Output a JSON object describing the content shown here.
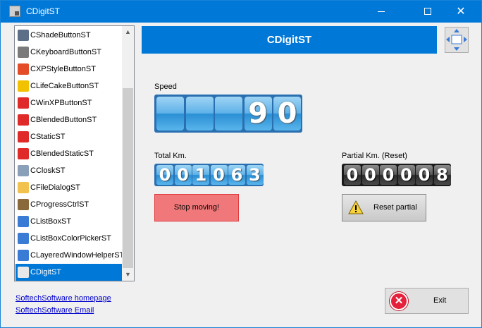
{
  "window": {
    "title": "CDigitST",
    "minimize": "—",
    "maximize": "☐",
    "close": "✕"
  },
  "sidebar": {
    "items": [
      {
        "label": "CShadeButtonST",
        "icon": "person-icon",
        "color": "#5b6f86"
      },
      {
        "label": "CKeyboardButtonST",
        "icon": "keyboard-icon",
        "color": "#7a7a7a"
      },
      {
        "label": "CXPStyleButtonST",
        "icon": "windows-xp-icon",
        "color": "#e34c26"
      },
      {
        "label": "CLifeCakeButtonST",
        "icon": "lifecake-icon",
        "color": "#f2c200"
      },
      {
        "label": "CWinXPButtonST",
        "icon": "color-ball-icon",
        "color": "#e02a2a"
      },
      {
        "label": "CBlendedButtonST",
        "icon": "color-ball-icon",
        "color": "#e02a2a"
      },
      {
        "label": "CStaticST",
        "icon": "color-ball-icon",
        "color": "#e02a2a"
      },
      {
        "label": "CBlendedStaticST",
        "icon": "color-ball-icon",
        "color": "#e02a2a"
      },
      {
        "label": "CCloskST",
        "icon": "clock-icon",
        "color": "#8aa0b8"
      },
      {
        "label": "CFileDialogST",
        "icon": "folder-icon",
        "color": "#f1c34e"
      },
      {
        "label": "CProgressCtrlST",
        "icon": "hourglass-icon",
        "color": "#8a6a3a"
      },
      {
        "label": "CListBoxST",
        "icon": "window-icon",
        "color": "#3a7bd5"
      },
      {
        "label": "CListBoxColorPickerST",
        "icon": "window-icon",
        "color": "#3a7bd5"
      },
      {
        "label": "CLayeredWindowHelperST",
        "icon": "window-icon",
        "color": "#3a7bd5"
      },
      {
        "label": "CDigitST",
        "icon": "digit-icon",
        "color": "#e8e8e8",
        "selected": true
      }
    ]
  },
  "header": {
    "title": "CDigitST"
  },
  "speed": {
    "label": "Speed",
    "digits": [
      "",
      "",
      "",
      "9",
      "0"
    ]
  },
  "total": {
    "label": "Total Km.",
    "digits": [
      "0",
      "0",
      "1",
      "0",
      "6",
      "3"
    ]
  },
  "partial": {
    "label": "Partial Km. (Reset)",
    "digits": [
      "0",
      "0",
      "0",
      "0",
      "0",
      "8"
    ]
  },
  "buttons": {
    "stop": "Stop moving!",
    "reset": "Reset partial",
    "exit": "Exit"
  },
  "links": {
    "homepage": "SoftechSoftware homepage",
    "email": "SoftechSoftware Email"
  },
  "colors": {
    "accent": "#0078d7",
    "stop_button": "#f0787a",
    "digit_blue": "#5fb2e8",
    "digit_dark": "#2a2a2a"
  }
}
